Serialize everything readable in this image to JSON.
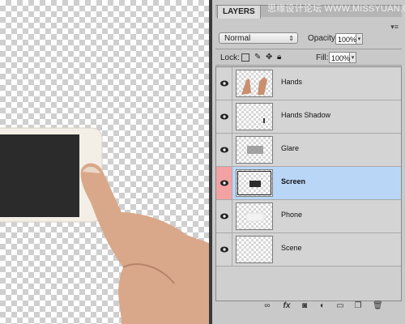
{
  "watermark": "思缘设计论坛 WWW.MISSYUAN.COM",
  "panel": {
    "tab_label": "LAYERS",
    "menu_icon": "panel-menu-icon",
    "blend_mode": "Normal",
    "opacity_label": "Opacity:",
    "opacity_value": "100%",
    "lock_label": "Lock:",
    "fill_label": "Fill:",
    "fill_value": "100%"
  },
  "layers": [
    {
      "name": "Hands",
      "selected": false
    },
    {
      "name": "Hands Shadow",
      "selected": false
    },
    {
      "name": "Glare",
      "selected": false
    },
    {
      "name": "Screen",
      "selected": true
    },
    {
      "name": "Phone",
      "selected": false
    },
    {
      "name": "Scene",
      "selected": false
    }
  ],
  "footer_icons": [
    "link-layers-icon",
    "fx-icon",
    "layer-mask-icon",
    "adjustment-layer-icon",
    "group-folder-icon",
    "new-layer-icon",
    "trash-icon"
  ],
  "colors": {
    "selected_row": "#b9d6f7",
    "visibility_highlight": "#f2a2a2"
  }
}
